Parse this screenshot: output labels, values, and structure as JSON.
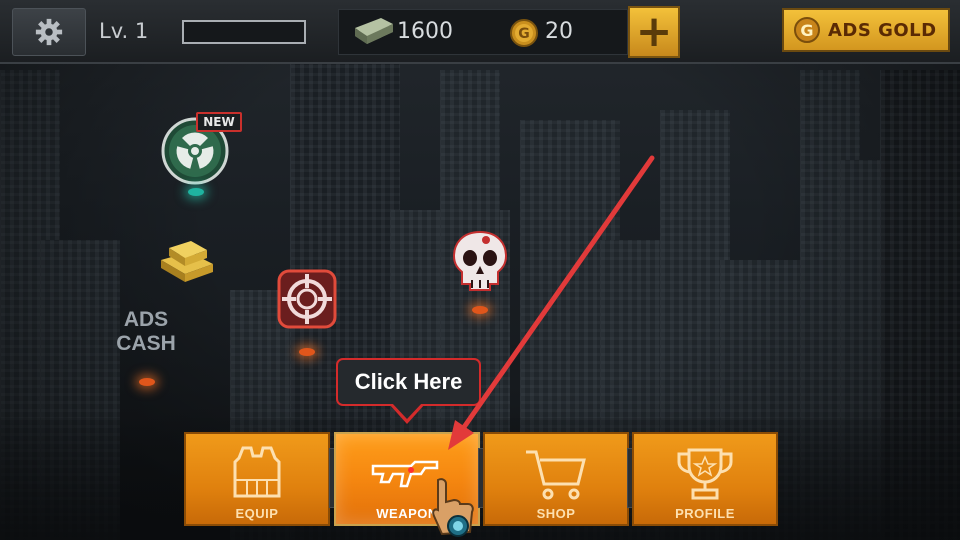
{
  "header": {
    "level_label": "Lv. 1",
    "xp_progress": 0,
    "cash_amount": "1600",
    "gold_amount": "20",
    "plus_label": "+",
    "ads_gold_label": "ADS GOLD",
    "ads_gold_coin": "G",
    "gold_coin_glyph": "G"
  },
  "map": {
    "new_badge": "NEW",
    "ads_cash_line1": "ADS",
    "ads_cash_line2": "CASH"
  },
  "tutorial": {
    "tooltip_text": "Click Here"
  },
  "nav": {
    "items": [
      {
        "label": "EQUIP",
        "icon": "vest-icon"
      },
      {
        "label": "WEAPON",
        "icon": "rifle-icon"
      },
      {
        "label": "SHOP",
        "icon": "cart-icon"
      },
      {
        "label": "PROFILE",
        "icon": "trophy-icon"
      }
    ],
    "active_index": 1
  },
  "colors": {
    "accent_orange": "#f09a1a",
    "tooltip_border": "#d42b2b",
    "arrow_red": "#e23a3a",
    "gold": "#f3c13a"
  }
}
